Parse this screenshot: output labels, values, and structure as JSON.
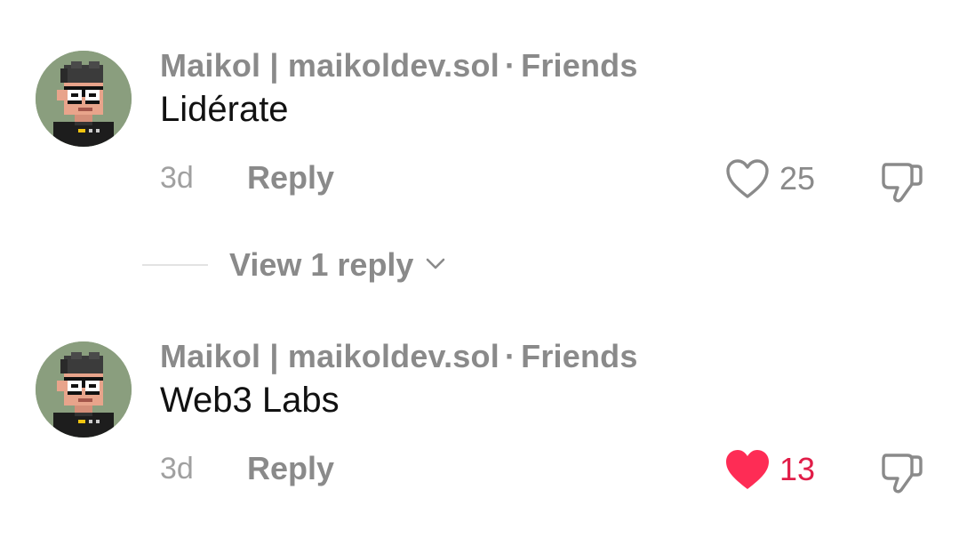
{
  "comments": [
    {
      "author": "Maikol | maikoldev.sol",
      "separator": "·",
      "relation": "Friends",
      "text": "Lidérate",
      "time": "3d",
      "reply_label": "Reply",
      "likes": "25",
      "liked": false
    },
    {
      "author": "Maikol | maikoldev.sol",
      "separator": "·",
      "relation": "Friends",
      "text": "Web3 Labs",
      "time": "3d",
      "reply_label": "Reply",
      "likes": "13",
      "liked": true
    }
  ],
  "view_replies": {
    "label": "View 1 reply",
    "icon": "chevron-down-icon"
  },
  "icons": [
    "heart-outline-icon",
    "heart-filled-icon",
    "dislike-icon",
    "chevron-down-icon"
  ],
  "colors": {
    "liked": "#fe2c55",
    "liked_count": "#e11d48",
    "muted": "#8a8a8a",
    "text": "#111111",
    "avatar_bg": "#8a9e7e"
  }
}
